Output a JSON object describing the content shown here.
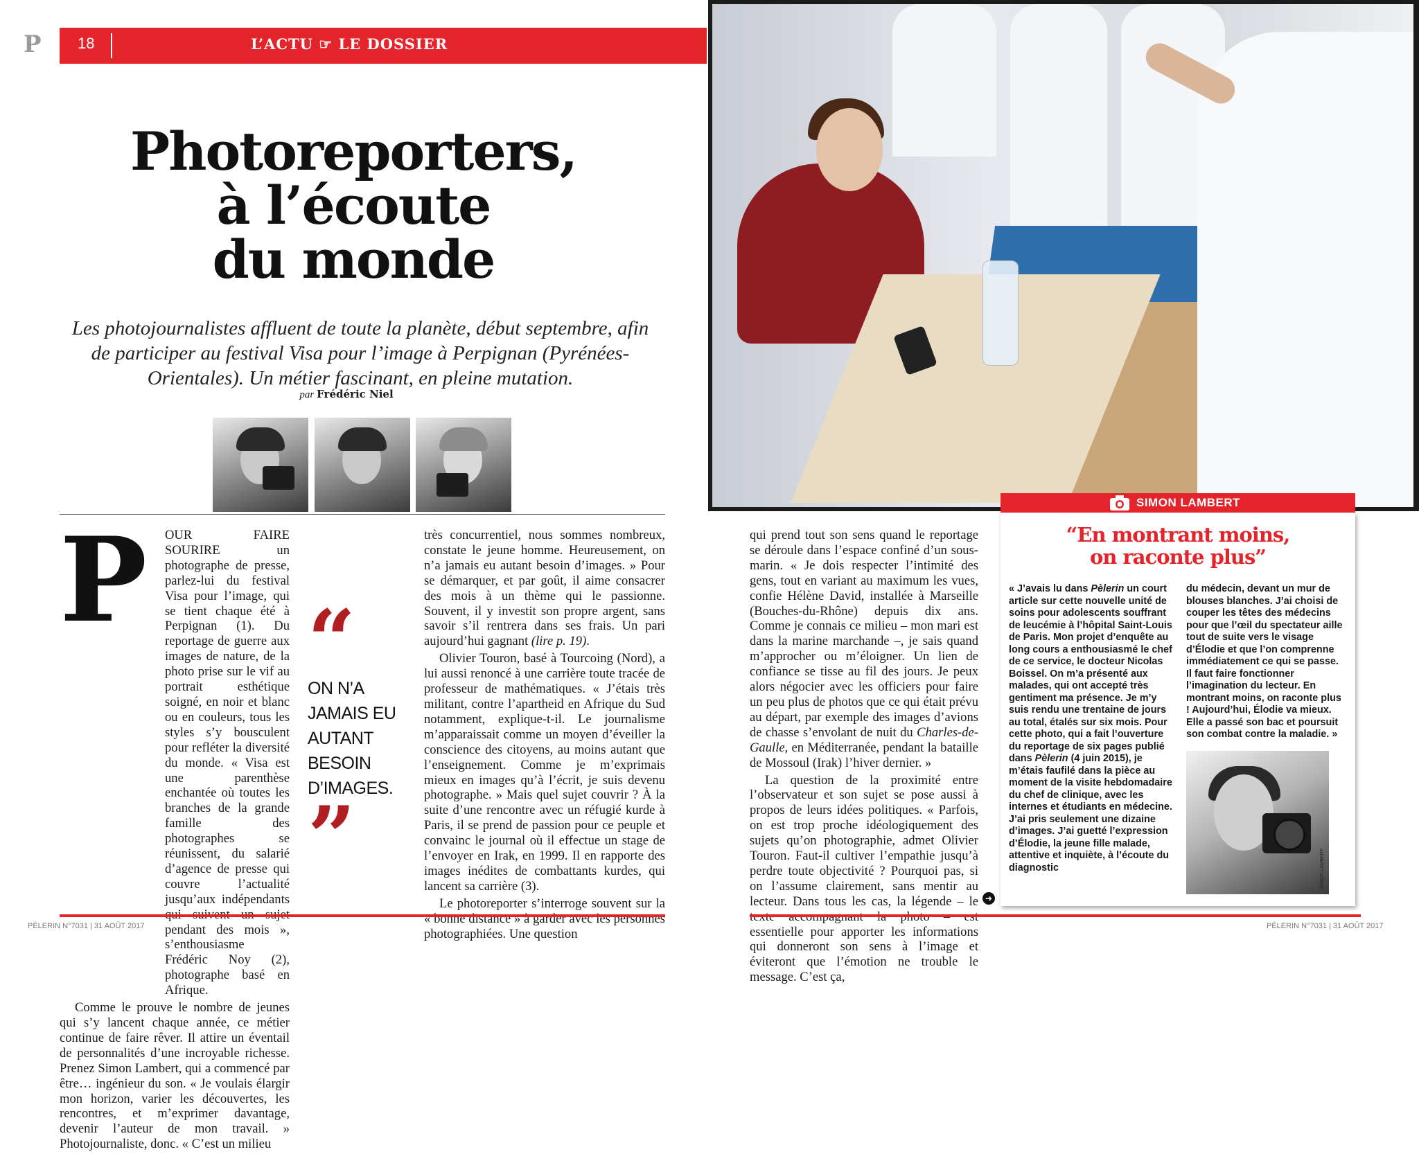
{
  "header": {
    "logo": "P",
    "page_number": "18",
    "rubric": "L’ACTU ☞ LE DOSSIER"
  },
  "article": {
    "title_lines": [
      "Photoreporters,",
      "à l’écoute",
      "du monde"
    ],
    "standfirst": "Les photojournalistes affluent de toute la planète, début septembre, afin de participer au festival Visa pour l’image à Perpignan (Pyrénées-Orientales). Un métier fascinant, en pleine mutation.",
    "byline_prefix": "par",
    "byline_author": "Frédéric Niel",
    "dropcap": "P",
    "col1_lead_caps": "OUR FAIRE SOURIRE",
    "col1_p1": " un photographe de presse, parlez-lui du festival Visa pour l’image, qui se tient chaque été à Perpignan (1). Du reportage de guerre aux images de nature, de la photo prise sur le vif au portrait esthétique soigné, en noir et blanc ou en couleurs, tous les styles s’y bousculent pour refléter la diversité du monde. « Visa est une parenthèse enchantée où toutes les branches de la grande famille des photographes se réunissent, du salarié d’agence de presse qui couvre l’actualité jusqu’aux indépendants qui suivent un sujet pendant des mois », s’enthousiasme Frédéric Noy (2), photographe basé en Afrique.",
    "col1_p2": "Comme le prouve le nombre de jeunes qui s’y lancent chaque année, ce métier continue de faire rêver. Il attire un éventail de personnalités d’une incroyable richesse. Prenez Simon Lambert, qui a commencé par être… ingénieur du son. « Je voulais élargir mon horizon, varier les découvertes, les rencontres, et m’exprimer davantage, devenir l’auteur de mon travail. » Photojournaliste, donc. « C’est un milieu",
    "pullquote": "ON N’A JAMAIS EU AUTANT BESOIN D’IMAGES.",
    "col2_p1_a": "très concurrentiel, nous sommes nombreux, constate le jeune homme. Heureusement, on n’a jamais eu autant besoin d’images. » Pour se démarquer, et par goût, il aime consacrer des mois à un thème qui le passionne. Souvent, il y investit son propre argent, sans savoir s’il rentrera dans ses frais. Un pari aujourd’hui gagnant ",
    "col2_p1_ref": "(lire p. 19)",
    "col2_p1_b": ".",
    "col2_p2": "Olivier Touron, basé à Tourcoing (Nord), a lui aussi renoncé à une carrière toute tracée de professeur de mathématiques. « J’étais très militant, contre l’apartheid en Afrique du Sud notamment, explique-t-il. Le journalisme m’apparaissait comme un moyen d’éveiller la conscience des citoyens, au moins autant que l’enseignement. Comme je m’exprimais mieux en images qu’à l’écrit, je suis devenu photographe. » Mais quel sujet couvrir ? À la suite d’une rencontre avec un réfugié kurde à Paris, il se prend de passion pour ce peuple et convainc le journal où il effectue un stage de l’envoyer en Irak, en 1999. Il en rapporte des images inédites de combattants kurdes, qui lancent sa carrière (3).",
    "col2_p3": "Le photoreporter s’interroge souvent sur la « bonne distance » à garder avec les personnes photographiées. Une question",
    "col3_p1_a": "qui prend tout son sens quand le reportage se déroule dans l’espace confiné d’un sous-marin. « Je dois respecter l’intimité des gens, tout en variant au maximum les vues, confie Hélène David, installée à Marseille (Bouches-du-Rhône) depuis dix ans. Comme je connais ce milieu – mon mari est dans la marine marchande –, je sais quand m’approcher ou m’éloigner. Un lien de confiance se tisse au fil des jours. Je peux alors négocier avec les officiers pour faire un peu plus de photos que ce qui était prévu au départ, par exemple des images d’avions de chasse s’envolant de nuit du ",
    "col3_p1_ship": "Charles-de-Gaulle",
    "col3_p1_b": ", en Méditerranée, pendant la bataille de Mossoul (Irak) l’hiver dernier. »",
    "col3_p2": "La question de la proximité entre l’observateur et son sujet se pose aussi à propos de leurs idées politiques. « Parfois, on est trop proche idéologiquement des sujets qu’on photographie, admet Olivier Touron. Faut-il cultiver l’empathie jusqu’à perdre toute objectivité ? Pourquoi pas, si on l’assume clairement, sans mentir au lecteur. Dans tous les cas, la légende – le texte accompagnant la photo – est essentielle pour apporter les informations qui donneront son sens à l’image et éviteront que l’émotion ne trouble le message. C’est ça,",
    "continue_icon": "arrow-right-icon"
  },
  "sidebar": {
    "credit_icon": "camera-icon",
    "photographer": "SIMON LAMBERT",
    "title_line1": "“En montrant moins,",
    "title_line2": "on raconte plus”",
    "col1_a": "« J’avais lu dans ",
    "col1_mag1": "Pèlerin",
    "col1_b": " un court article sur cette nouvelle unité de soins pour adolescents souffrant de leucémie à l’hôpital Saint-Louis de Paris. Mon projet d’enquête au long cours a enthousiasmé le chef de ce service, le docteur Nicolas Boissel. On m’a présenté aux malades, qui ont accepté très gentiment ma présence. Je m’y suis rendu une trentaine de jours au total, étalés sur six mois. Pour cette photo, qui a fait l’ouverture du reportage de six pages publié dans ",
    "col1_mag2": "Pèlerin",
    "col1_c": " (4 juin 2015), je m’étais faufilé dans la pièce au moment de la visite hebdomadaire du chef de clinique, avec les internes et étudiants en médecine. J’ai pris seulement une dizaine d’images. J’ai guetté l’expression d’Élodie, la jeune fille malade, attentive et inquiète, à l’écoute du diagnostic",
    "col2": "du médecin, devant un mur de blouses blanches. J’ai choisi de couper les têtes des médecins pour que l’œil du spectateur aille tout de suite vers le visage d’Élodie et que l’on comprenne immédiatement ce qui se passe. Il faut faire fonctionner l’imagination du lecteur. En montrant moins, on raconte plus ! Aujourd’hui, Élodie va mieux. Elle a passé son bac et poursuit son combat contre la maladie. »",
    "portrait_credit": "SIMON LAMBERT"
  },
  "footer": {
    "left": "PÈLERIN N°7031 | 31 AOÛT 2017",
    "right": "PÈLERIN N°7031 | 31 AOÛT 2017"
  },
  "colors": {
    "accent_red": "#e3242b",
    "quote_red": "#b01e22"
  }
}
